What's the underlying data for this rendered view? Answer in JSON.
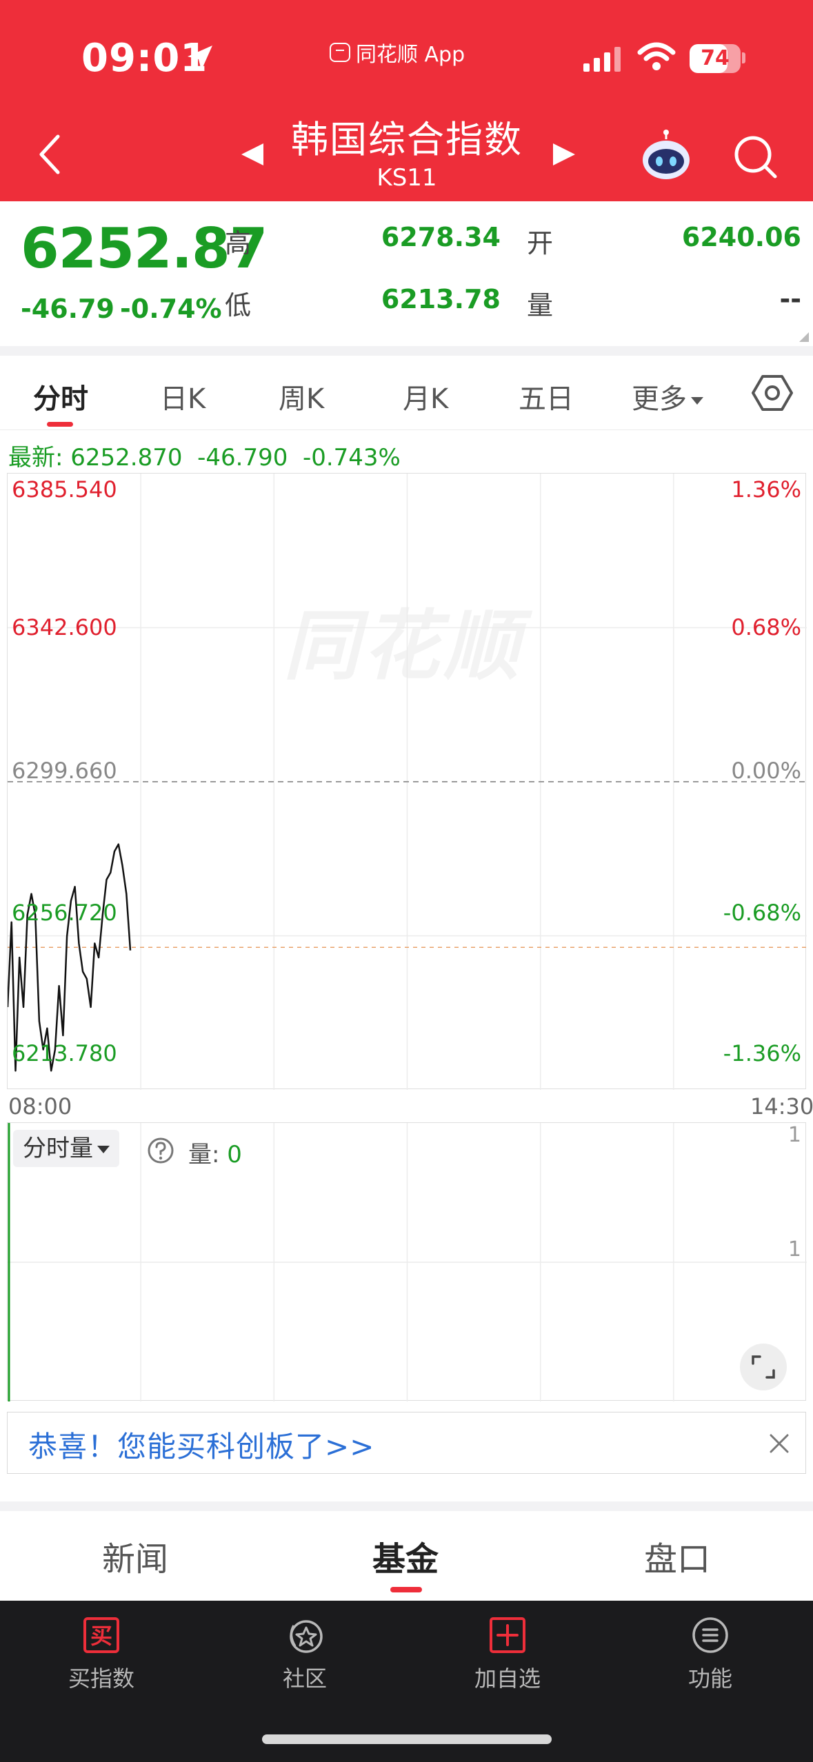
{
  "status_bar": {
    "time": "09:01",
    "app_name": "同花顺 App",
    "battery": "74",
    "battery_level": 0.74
  },
  "nav": {
    "title": "韩国综合指数",
    "code": "KS11"
  },
  "quote": {
    "price": "6252.87",
    "change": "-46.79",
    "change_pct": "-0.74%",
    "high_label": "高",
    "high": "6278.34",
    "low_label": "低",
    "low": "6213.78",
    "open_label": "开",
    "open": "6240.06",
    "volume_label": "量",
    "volume": "--"
  },
  "chart_tabs": [
    "分时",
    "日K",
    "周K",
    "月K",
    "五日",
    "更多"
  ],
  "latest_line": "最新: 6252.870  -46.790  -0.743%",
  "chart_data": {
    "type": "line",
    "x_start": "08:00",
    "x_end": "14:30",
    "y_left_ticks": [
      "6385.540",
      "6342.600",
      "6299.660",
      "6256.720",
      "6213.780"
    ],
    "y_right_ticks": [
      "1.36%",
      "0.68%",
      "0.00%",
      "-0.68%",
      "-1.36%"
    ],
    "ylim": [
      6213.78,
      6385.54
    ],
    "baseline": 6299.66,
    "latest": 6252.87,
    "colors": {
      "up": "#e0202e",
      "down": "#1a9c24",
      "line": "#111111",
      "baseline": "#999999"
    },
    "series": [
      {
        "values": [
          6236,
          6260,
          6218,
          6250,
          6236,
          6262,
          6268,
          6262,
          6232,
          6224,
          6230,
          6218,
          6224,
          6242,
          6228,
          6256,
          6266,
          6270,
          6254,
          6246,
          6244,
          6236,
          6254,
          6250,
          6262,
          6272,
          6274,
          6280,
          6282,
          6276,
          6268,
          6252
        ]
      }
    ]
  },
  "volume": {
    "selector": "分时量",
    "label": "量: ",
    "value": "0",
    "tick_top": "1",
    "tick_mid": "1"
  },
  "promo": {
    "text": "恭喜！您能买科创板了>>"
  },
  "section_tabs": [
    "新闻",
    "基金",
    "盘口"
  ],
  "tabbar": [
    {
      "label": "买指数",
      "icon": "buy-icon"
    },
    {
      "label": "社区",
      "icon": "community-icon"
    },
    {
      "label": "加自选",
      "icon": "add-watchlist-icon"
    },
    {
      "label": "功能",
      "icon": "menu-icon"
    }
  ]
}
